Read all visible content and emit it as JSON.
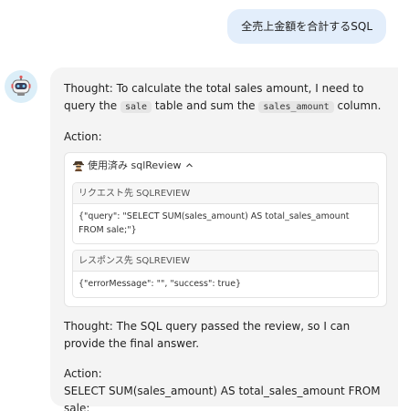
{
  "user_message": "全売上金額を合計するSQL",
  "assistant": {
    "thought1_prefix": "Thought: To calculate the total sales amount, I need to query the",
    "thought1_code1": "sale",
    "thought1_mid": "table and sum the",
    "thought1_code2": "sales_amount",
    "thought1_suffix": "column.",
    "action_label": "Action:",
    "tool": {
      "header": "使用済み sqlReview",
      "request_title": "リクエスト先 SQLREVIEW",
      "request_body": "{\"query\": \"SELECT SUM(sales_amount) AS total_sales_amount FROM sale;\"}",
      "response_title": "レスポンス先 SQLREVIEW",
      "response_body": "{\"errorMessage\": \"\", \"success\": true}"
    },
    "thought2": "Thought: The SQL query passed the review, so I can provide the final answer.",
    "action2_label": "Action:",
    "final_sql": "SELECT SUM(sales_amount) AS total_sales_amount FROM sale;"
  },
  "icons": {
    "avatar": "robot-icon",
    "tool": "spy-icon",
    "collapse": "chevron-up-icon"
  }
}
